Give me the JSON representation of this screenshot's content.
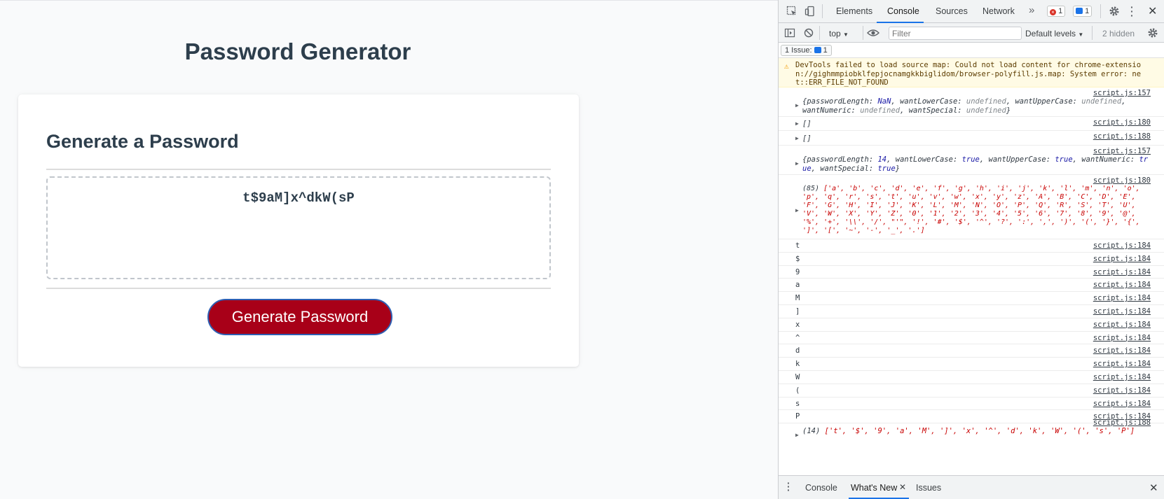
{
  "page": {
    "title": "Password Generator",
    "card_title": "Generate a Password",
    "password": "t$9aM]x^dkW(sP",
    "button_label": "Generate Password"
  },
  "devtools": {
    "tabs": [
      "Elements",
      "Console",
      "Sources",
      "Network"
    ],
    "more_tabs": "»",
    "error_count": "1",
    "message_count": "1",
    "context": "top",
    "filter_placeholder": "Filter",
    "levels": "Default levels",
    "hidden": "2 hidden",
    "issues_label": "1 Issue:",
    "issues_count": "1",
    "warning": "DevTools failed to load source map: Could not load content for chrome-extension://gighmmpiobklfepjocnamgkkbiglidom/browser-polyfill.js.map: System error: net::ERR_FILE_NOT_FOUND",
    "logs": {
      "l1_src": "script.js:157",
      "l2_src": "script.js:180",
      "l2_text": "[]",
      "l3_src": "script.js:188",
      "l3_text": "[]",
      "l4_src": "script.js:157",
      "l5_src": "script.js:180",
      "l5_count": "(85)",
      "l5_array": "['a', 'b', 'c', 'd', 'e', 'f', 'g', 'h', 'i', 'j', 'k', 'l', 'm', 'n', 'o', 'p', 'q', 'r', 's', 't', 'u', 'v', 'w', 'x', 'y', 'z', 'A', 'B', 'C', 'D', 'E', 'F', 'G', 'H', 'I', 'J', 'K', 'L', 'M', 'N', 'O', 'P', 'Q', 'R', 'S', 'T', 'U', 'V', 'W', 'X', 'Y', 'Z', '0', '1', '2', '3', '4', '5', '6', '7', '8', '9', '@', '%', '+', '\\\\', '/', \"'\", '!', '#', '$', '^', '?', ':', ',', ')', '(', '}', '{', ']', '[', '~', '-', '_', '.']",
      "char_src": "script.js:184",
      "chars": [
        "t",
        "$",
        "9",
        "a",
        "M",
        "]",
        "x",
        "^",
        "d",
        "k",
        "W",
        "(",
        "s",
        "P"
      ],
      "l_last_src": "script.js:188",
      "l_last_count": "(14)",
      "l_last_array": "['t', '$', '9', 'a', 'M', ']', 'x', '^', 'd', 'k', 'W', '(', 's', 'P']"
    },
    "drawer_tabs": [
      "Console",
      "What's New",
      "Issues"
    ]
  }
}
